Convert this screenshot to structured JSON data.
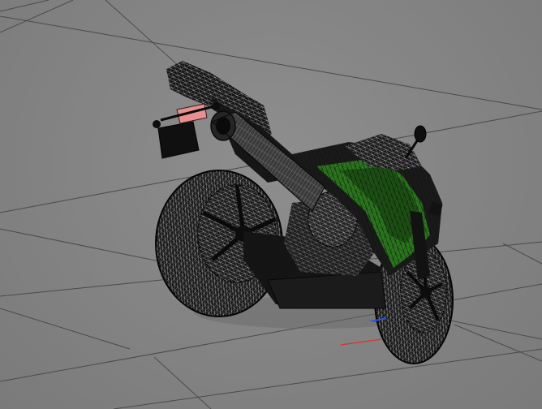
{
  "viewport": {
    "view_mode": "wireframe-on-shaded",
    "background_color": "#858585",
    "grid_color": "#4a4a4a",
    "model": {
      "name": "motorcycle",
      "body_color": "#1a1a1a",
      "accent_color": "#2e8b1e",
      "taillight_color": "#e89090"
    },
    "axes": {
      "x_color": "#e03030",
      "z_color": "#3050e0"
    }
  }
}
